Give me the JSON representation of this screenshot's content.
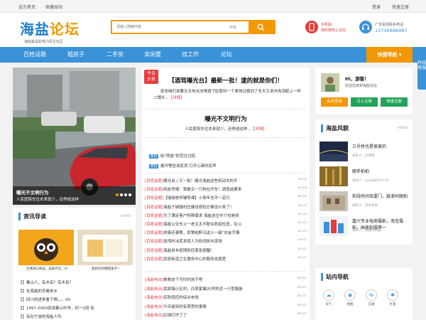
{
  "topbar": {
    "set_home": "设为首页",
    "bookmark": "收藏本站",
    "login": "登录",
    "register": "快速注册"
  },
  "header": {
    "logo_a": "海盐",
    "logo_b": "论坛",
    "slogan": "海盐最具影响力民生社区",
    "search": {
      "placeholder": "请输入搜索内容",
      "select": "搜索"
    },
    "mobile": {
      "l1": "手机版",
      "l2": "随时随地上论坛"
    },
    "ad": {
      "l1": "广告投放联系电话",
      "l2": "13736888987"
    }
  },
  "nav": {
    "items": [
      "百姓话题",
      "租房子",
      "二手房",
      "卖闲置",
      "找工作",
      "论坛"
    ],
    "quick": "快捷导航"
  },
  "side_tab": "有线客服",
  "slider": {
    "title": "曝光不文明行为",
    "desc": "人民医院车位本来就少，还停成这样",
    "dots": 4
  },
  "headline": {
    "badge_a": "今日",
    "badge_b": "头条",
    "title": "【酒驾曝光台】最新一批！逮的就是你们！",
    "summary": "原本咱们说要天天热冰冻啤酒下肚那叫一个爽快过瘾到了冬天又说半肉汤配上一杯二锅头...",
    "detail": "【详情】"
  },
  "second": {
    "title": "曝光不文明行为",
    "summary": "人民医院车位本来就少，还停成这样...",
    "detail": "【详情】"
  },
  "hot": [
    {
      "tag": "原创",
      "text": "给\"两盐\"防范过过招"
    },
    {
      "tag": "原创",
      "text": "敢开警告说民货 打开心扉听民声"
    }
  ],
  "list1": [
    {
      "cat": "[百姓话题]",
      "title": "曝光台 | 又一批！曝光海盐这些机动车的不",
      "date": "10-18"
    },
    {
      "cat": "[百姓话题]",
      "title": "网友举报：我看见一只狗在开车！调查结果来",
      "date": "10-18"
    },
    {
      "cat": "[百姓话题]",
      "title": "【瑞伽老师辅导课】小青年也不一定行",
      "date": "10-18"
    },
    {
      "cat": "[百姓话题]",
      "title": "海盐于城镇村庄建设规划方案设计来了！",
      "date": "10-23"
    },
    {
      "cat": "[百姓话题]",
      "title": "为了满足客户特殊需求 海盐这位中介也是拼",
      "date": "10-23"
    },
    {
      "cat": "[百姓话题]",
      "title": "海盐公交车上一老太太不配合防疫检查，在公",
      "date": "10-23"
    },
    {
      "cat": "[百姓话题]",
      "title": "闹事还袭警，民警给醉汉送上一副\"白金手镯",
      "date": "10-23"
    },
    {
      "cat": "[百姓话题]",
      "title": "张湾村冰库发现人为砍伐树木现场",
      "date": "10-21"
    },
    {
      "cat": "[百姓话题]",
      "title": "海盐发布疫情防控紧急提醒！",
      "date": "10-21"
    },
    {
      "cat": "[百姓话题]",
      "title": "武原街道卫生服务中心的服务态度差",
      "date": "10-21"
    }
  ],
  "list2": [
    {
      "cat": "[海盐电台]",
      "title": "救救这个可怜的孩子吧",
      "date": "05-21"
    },
    {
      "cat": "[海盐电台]",
      "title": "武原镇小区村，白吴家塘20号附近一小型服装",
      "date": "05-21"
    },
    {
      "cat": "[海盐电台]",
      "title": "实防庭控的综合布线",
      "date": "05-21"
    },
    {
      "cat": "[海盐电台]",
      "title": "今天碰到的有意思的事情",
      "date": "05-21"
    },
    {
      "cat": "[海盐电台]",
      "title": "红绿灯坏了了",
      "date": "05-21"
    }
  ],
  "news": {
    "title": "资讯导读",
    "more": "MORE",
    "tiles": [
      {
        "caption": "全球进口商品，品质齐全，价"
      },
      {
        "caption": "超好吃的懒苗金子~"
      }
    ],
    "items": [
      "【】秦山人，有木有？有木有？",
      "【】在海盐的安徽老乡",
      "【】四川的进来看下啊。。。00",
      "【】1997-2000就读秦山中学，初一2班 有",
      "【】有在宁波的海盐人吗"
    ]
  },
  "login": {
    "hi": "Hi，游客！",
    "welcome": "欢迎您来到海盐论坛",
    "buttons": [
      "会员登录",
      "马上注册",
      "快速注册"
    ]
  },
  "fengmao": {
    "title": "海盐风貌",
    "more": "MORE",
    "items": [
      {
        "title": "三号桥也是很美的",
        "author": "发布人：大雪阴"
      },
      {
        "title": "随手拍拍",
        "author": "发布人：song20071122"
      },
      {
        "title": "前段时间去厦门，鼓浪屿随拍",
        "author": "发布人：花木剪尚"
      },
      {
        "title": "嘉兴专业电商摄影，淘宝摄影，画册拍摄等一",
        "author": "发布人：消搬的蚂蚁"
      }
    ]
  },
  "station": {
    "title": "站内导航",
    "items": [
      {
        "icon": "☁",
        "label": "天气"
      },
      {
        "icon": "◉",
        "label": "地图"
      },
      {
        "icon": "⇆",
        "label": "交通"
      },
      {
        "icon": "✱",
        "label": "水电"
      }
    ]
  },
  "colors": {
    "primary": "#3a92d8",
    "accent": "#f39800",
    "red": "#e63c3c",
    "green": "#22a35a"
  }
}
